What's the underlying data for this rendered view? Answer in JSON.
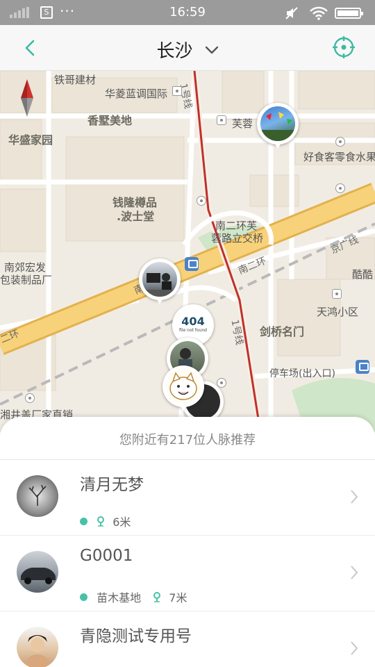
{
  "status_bar": {
    "time": "16:59"
  },
  "header": {
    "city": "长沙"
  },
  "map": {
    "labels": {
      "tiege": "铁哥建材",
      "hualing": "华菱蓝调国际",
      "xiangshu": "香墅美地",
      "huasheng": "华盛家园",
      "furong": "芙蓉",
      "haoshike": "好食客零食水果",
      "line1_top": "1号线",
      "qianlong1": "钱隆樽品",
      "qianlong2": ".波士堂",
      "nanerhuan1": "南二环芙",
      "nanerhuan2": "蓉路立交桥",
      "jingguang": "京广线",
      "kuku": "酷酷",
      "nanjiao1": "南郊宏发",
      "nanjiao2": "包装制品厂",
      "tianhong": "天鸿小区",
      "nanerhuan_road": "南二环",
      "nan_left": "南",
      "er_huan_left": "二环",
      "jianqiao": "剑桥名门",
      "line1_bottom": "1号线",
      "parking": "停车场(出入口)",
      "xiangjing": "湘井盖厂家直销"
    },
    "pins": [
      {
        "icon": "kites-photo"
      },
      {
        "icon": "office-photo"
      },
      {
        "caption": "404",
        "sub": "file not found"
      },
      {
        "icon": "person-photo"
      },
      {
        "icon": "cartoon-cat-photo"
      }
    ]
  },
  "banner": {
    "text": "您附近有217位人脉推荐"
  },
  "people": [
    {
      "name": "清月无梦",
      "tag": "",
      "distance": "6米"
    },
    {
      "name": "G0001",
      "tag": "苗木基地",
      "distance": "7米"
    },
    {
      "name": "青隐测试专用号",
      "tag": "",
      "distance": ""
    }
  ],
  "colors": {
    "accent": "#48c1a8",
    "status_bar": "#9b9b9b",
    "road": "#f2c45a",
    "metro": "#c0302a"
  }
}
